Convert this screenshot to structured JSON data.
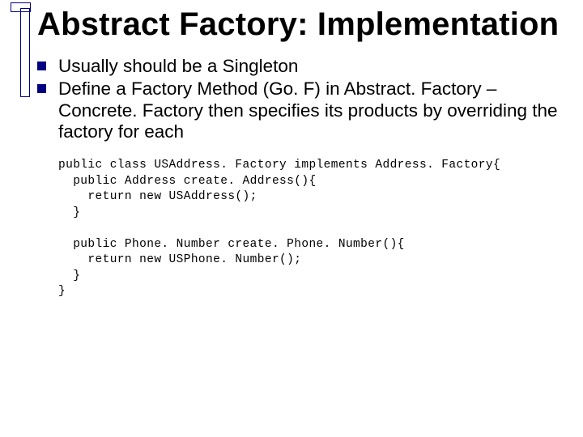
{
  "title": "Abstract Factory: Implementation",
  "bullets": [
    "Usually should be a Singleton",
    "Define a Factory Method (Go. F) in Abstract. Factory – Concrete. Factory then specifies its products by overriding the factory for each"
  ],
  "code": "public class USAddress. Factory implements Address. Factory{\n  public Address create. Address(){\n    return new USAddress();\n  }\n\n  public Phone. Number create. Phone. Number(){\n    return new USPhone. Number();\n  }\n}"
}
